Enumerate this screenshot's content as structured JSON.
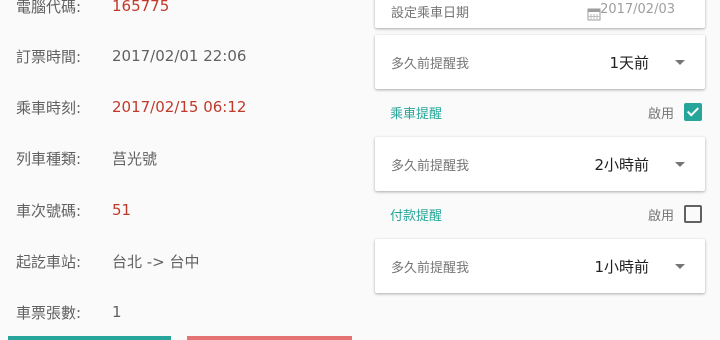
{
  "ticket": {
    "rows": [
      {
        "label": "電腦代碼:",
        "value": "165775"
      },
      {
        "label": "訂票時間:",
        "value": "2017/02/01 22:06"
      },
      {
        "label": "乘車時刻:",
        "value": "2017/02/15 06:12"
      },
      {
        "label": "列車種類:",
        "value": "莒光號"
      },
      {
        "label": "車次號碼:",
        "value": "51"
      },
      {
        "label": "起訖車站:",
        "value": "台北 -> 台中"
      },
      {
        "label": "車票張數:",
        "value": "1"
      }
    ]
  },
  "reminders": {
    "booking_date": {
      "label": "設定乘車日期",
      "value": "2017/02/03"
    },
    "booking_advance": {
      "label": "多久前提醒我",
      "value": "1天前"
    },
    "ride": {
      "title": "乘車提醒",
      "enable_label": "啟用",
      "enabled": true,
      "advance": {
        "label": "多久前提醒我",
        "value": "2小時前"
      }
    },
    "payment": {
      "title": "付款提醒",
      "enable_label": "啟用",
      "enabled": false,
      "advance": {
        "label": "多久前提醒我",
        "value": "1小時前"
      }
    }
  },
  "colors": {
    "accent": "#26a69a",
    "highlight_red": "#c0392b",
    "left_button": "#26a69a",
    "right_button": "#e57373"
  },
  "icons": {
    "calendar": "calendar-icon",
    "dropdown": "chevron-down-icon",
    "checkbox": "checkbox-icon"
  }
}
